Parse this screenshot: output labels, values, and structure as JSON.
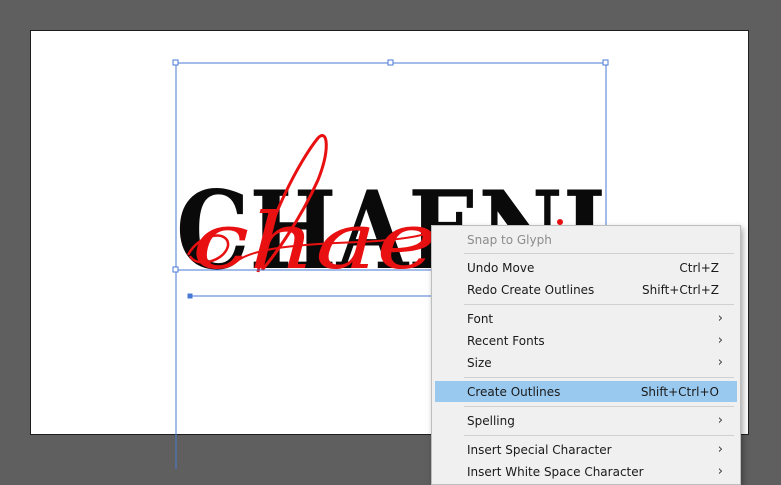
{
  "artboard": {
    "background": "#ffffff"
  },
  "artwork": {
    "main_text": "CHAENI",
    "script_text": "chae",
    "main_color": "#0a0a0a",
    "script_color": "#e81010",
    "selection_color": "#4a78d6"
  },
  "context_menu": {
    "highlight_color": "#99c9ef",
    "items": [
      {
        "label": "Snap to Glyph",
        "shortcut": "",
        "disabled": true
      },
      {
        "label": "Undo Move",
        "shortcut": "Ctrl+Z"
      },
      {
        "label": "Redo Create Outlines",
        "shortcut": "Shift+Ctrl+Z"
      },
      {
        "label": "Font",
        "submenu": true
      },
      {
        "label": "Recent Fonts",
        "submenu": true
      },
      {
        "label": "Size",
        "submenu": true
      },
      {
        "label": "Create Outlines",
        "shortcut": "Shift+Ctrl+O",
        "highlighted": true
      },
      {
        "label": "Spelling",
        "submenu": true
      },
      {
        "label": "Insert Special Character",
        "submenu": true
      },
      {
        "label": "Insert White Space Character",
        "submenu": true
      }
    ]
  }
}
